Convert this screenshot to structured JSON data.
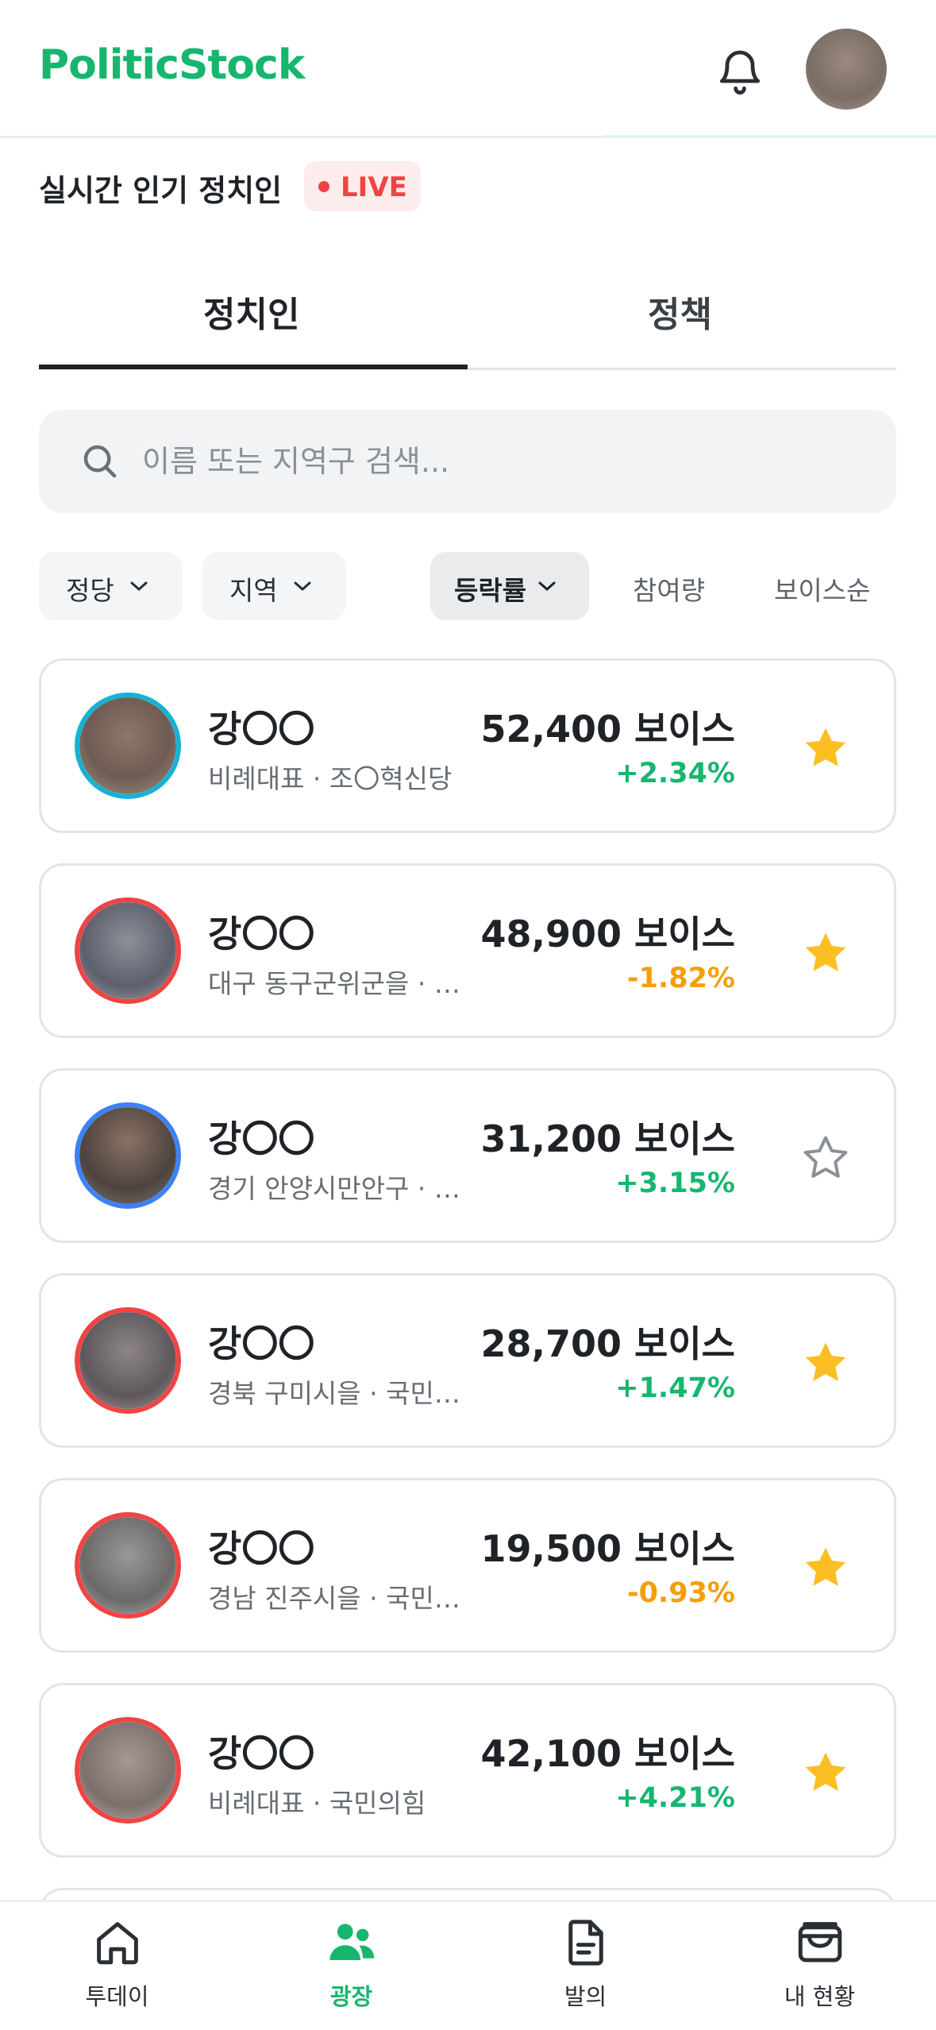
{
  "header": {
    "brand": "PoliticStock",
    "icons": [
      "bell-icon",
      "user-avatar"
    ]
  },
  "live": {
    "title": "실시간 인기 정치인",
    "badge": "LIVE"
  },
  "tabs": [
    {
      "label": "정치인",
      "active": true
    },
    {
      "label": "정책",
      "active": false
    }
  ],
  "search": {
    "placeholder": "이름 또는 지역구 검색..."
  },
  "filters": {
    "party": "정당",
    "region": "지역",
    "rate": "등락률",
    "participation": "참여량",
    "voice_order": "보이스순"
  },
  "politicians": [
    {
      "name": "강〇〇",
      "desc": "비례대표 · 조〇혁신당",
      "voice": "52,400 보이스",
      "change": "+2.34%",
      "trend": "up",
      "ring": "#16b2d4",
      "starred": true
    },
    {
      "name": "강〇〇",
      "desc": "대구 동구군위군을 · 국민의힘",
      "voice": "48,900 보이스",
      "change": "-1.82%",
      "trend": "down",
      "ring": "#ef4444",
      "starred": true
    },
    {
      "name": "강〇〇",
      "desc": "경기 안양시만안구 · 더불어민주당",
      "voice": "31,200 보이스",
      "change": "+3.15%",
      "trend": "up",
      "ring": "#3b82f6",
      "starred": false
    },
    {
      "name": "강〇〇",
      "desc": "경북 구미시을 · 국민의힘",
      "voice": "28,700 보이스",
      "change": "+1.47%",
      "trend": "up",
      "ring": "#ef4444",
      "starred": true
    },
    {
      "name": "강〇〇",
      "desc": "경남 진주시을 · 국민의힘",
      "voice": "19,500 보이스",
      "change": "-0.93%",
      "trend": "down",
      "ring": "#ef4444",
      "starred": true
    },
    {
      "name": "강〇〇",
      "desc": "비례대표 · 국민의힘",
      "voice": "42,100 보이스",
      "change": "+4.21%",
      "trend": "up",
      "ring": "#ef4444",
      "starred": true
    }
  ],
  "bottom_nav": [
    {
      "label": "투데이",
      "icon": "home-icon",
      "active": false
    },
    {
      "label": "광장",
      "icon": "people-icon",
      "active": true
    },
    {
      "label": "발의",
      "icon": "document-icon",
      "active": false
    },
    {
      "label": "내 현황",
      "icon": "wallet-icon",
      "active": false
    }
  ],
  "colors": {
    "brand": "#17b66f",
    "up": "#17b66f",
    "down": "#f59e0b",
    "live": "#ef4444",
    "star": "#fbbf24"
  }
}
